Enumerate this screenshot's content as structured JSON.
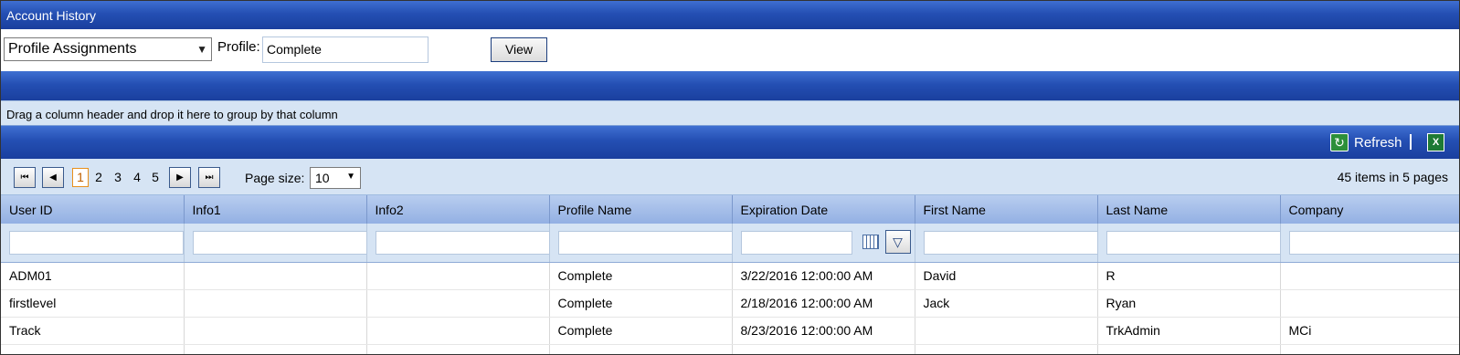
{
  "window": {
    "title": "Account History"
  },
  "toolbar": {
    "report_select": "Profile Assignments",
    "profile_label": "Profile:",
    "profile_value": "Complete",
    "view_label": "View"
  },
  "group_hint": "Drag a column header and drop it here to group by that column",
  "commands": {
    "refresh_label": "Refresh"
  },
  "pager": {
    "pages": [
      "1",
      "2",
      "3",
      "4",
      "5"
    ],
    "current_page": "1",
    "page_size_label": "Page size:",
    "page_size_value": "10",
    "items_info": "45 items in 5 pages"
  },
  "grid": {
    "columns": [
      "User ID",
      "Info1",
      "Info2",
      "Profile Name",
      "Expiration Date",
      "First Name",
      "Last Name",
      "Company"
    ],
    "rows": [
      [
        "ADM01",
        "",
        "",
        "Complete",
        "3/22/2016 12:00:00 AM",
        "David",
        "R",
        ""
      ],
      [
        "firstlevel",
        "",
        "",
        "Complete",
        "2/18/2016 12:00:00 AM",
        "Jack",
        "Ryan",
        ""
      ],
      [
        "Track",
        "",
        "",
        "Complete",
        "8/23/2016 12:00:00 AM",
        "",
        "TrkAdmin",
        "MCi"
      ]
    ]
  }
}
